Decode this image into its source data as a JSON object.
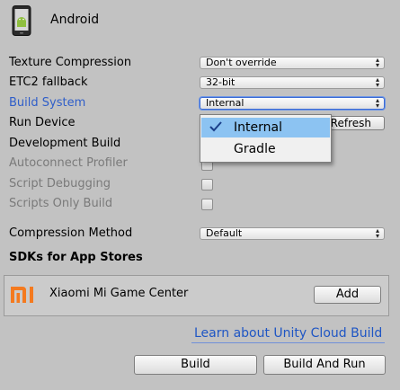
{
  "header": {
    "platform_name": "Android",
    "icon": "android-phone-icon"
  },
  "settings": {
    "texture_compression": {
      "label": "Texture Compression",
      "value": "Don't override"
    },
    "etc2_fallback": {
      "label": "ETC2 fallback",
      "value": "32-bit"
    },
    "build_system": {
      "label": "Build System",
      "value": "Internal"
    },
    "run_device": {
      "label": "Run Device",
      "refresh_label": "Refresh"
    },
    "development_build": {
      "label": "Development Build"
    },
    "autoconnect_profiler": {
      "label": "Autoconnect Profiler"
    },
    "script_debugging": {
      "label": "Script Debugging"
    },
    "scripts_only_build": {
      "label": "Scripts Only Build"
    },
    "compression_method": {
      "label": "Compression Method",
      "value": "Default"
    }
  },
  "build_system_menu": {
    "options": [
      {
        "label": "Internal",
        "checked": true
      },
      {
        "label": "Gradle",
        "checked": false
      }
    ]
  },
  "sdks": {
    "heading": "SDKs for App Stores",
    "items": [
      {
        "name": "Xiaomi Mi Game Center",
        "add_label": "Add",
        "logo": "xiaomi-mi-logo"
      }
    ]
  },
  "footer": {
    "cloud_build_link": "Learn about Unity Cloud Build",
    "build_label": "Build",
    "build_and_run_label": "Build And Run"
  },
  "colors": {
    "background": "#c2c2c2",
    "accent_blue": "#2f5ec9",
    "menu_highlight": "#8cc3f2",
    "xiaomi_orange": "#f47a1f",
    "link": "#1f56c4"
  }
}
